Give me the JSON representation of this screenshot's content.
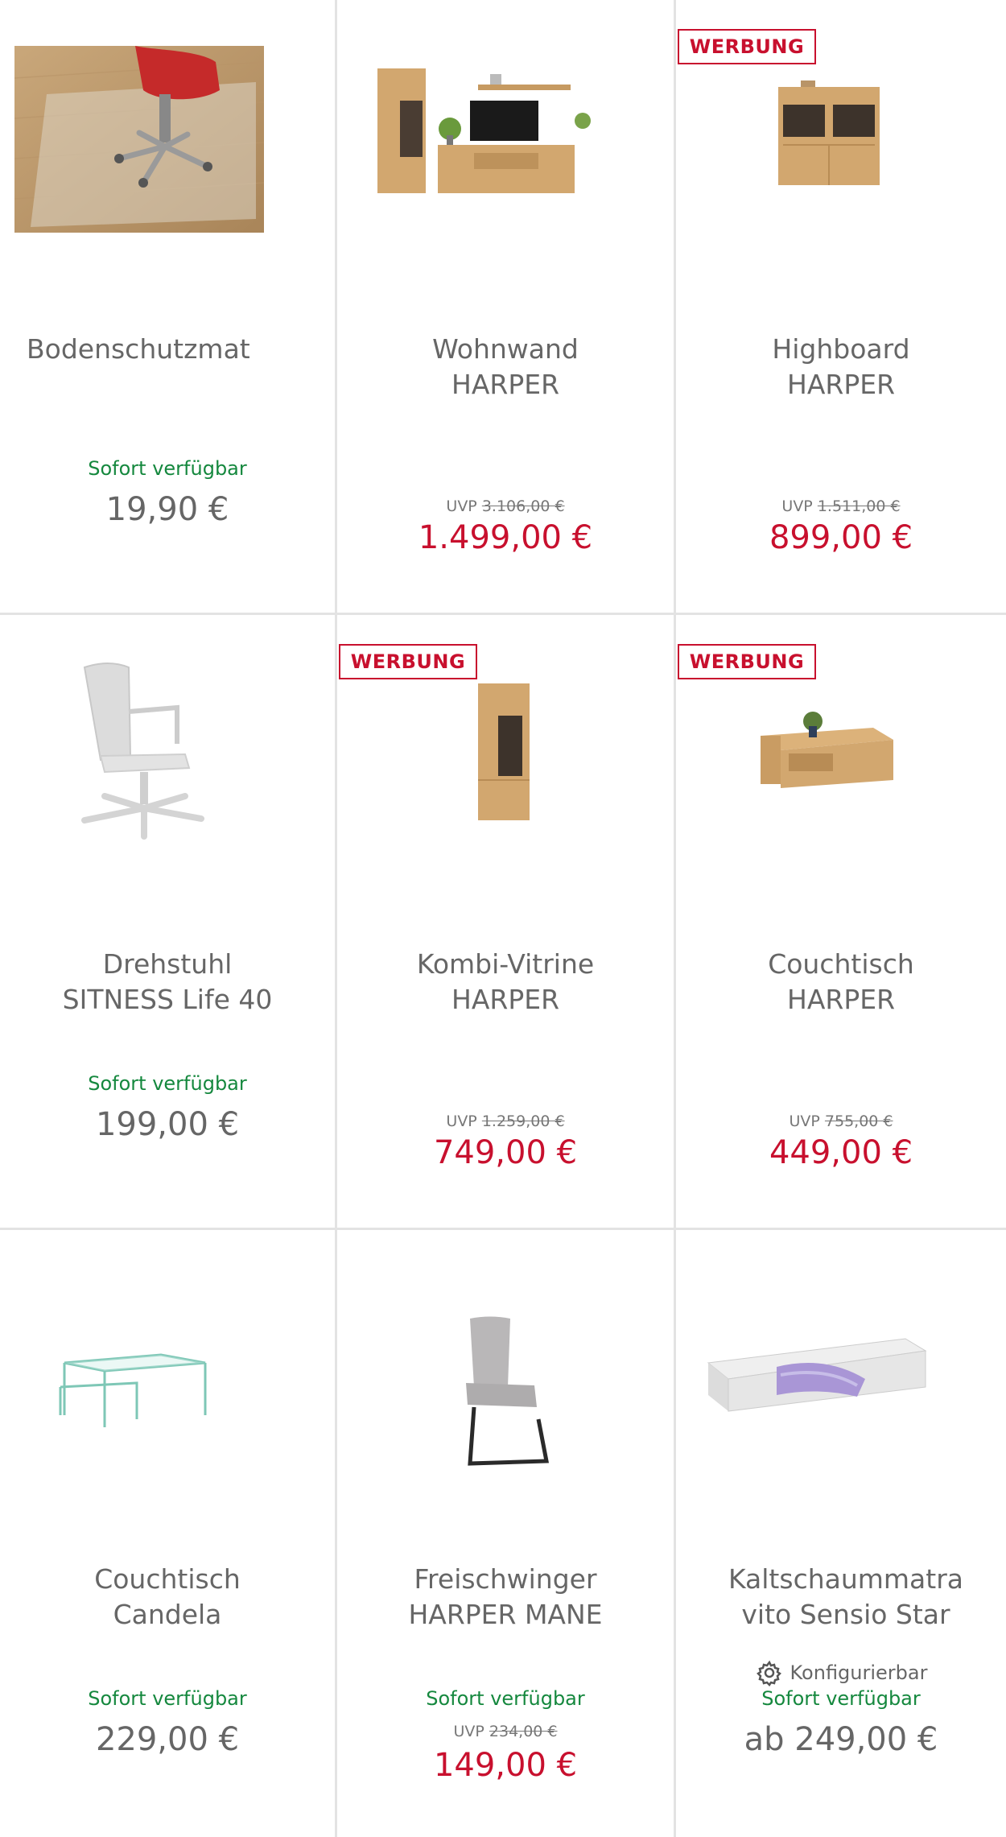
{
  "products": [
    {
      "badge": "",
      "title_line1": "Bodenschutzmat",
      "title_line2": "",
      "availability": "Sofort verfügbar",
      "uvp_label": "",
      "uvp_price": "",
      "price": "19,90 €",
      "image": "floor-mat-image"
    },
    {
      "badge": "",
      "title_line1": "Wohnwand",
      "title_line2": "HARPER",
      "availability": "",
      "uvp_label": "UVP",
      "uvp_price": "3.106,00 €",
      "price": "1.499,00 €",
      "image": "wall-unit-image"
    },
    {
      "badge": "WERBUNG",
      "title_line1": "Highboard",
      "title_line2": "HARPER",
      "availability": "",
      "uvp_label": "UVP",
      "uvp_price": "1.511,00 €",
      "price": "899,00 €",
      "image": "highboard-image"
    },
    {
      "badge": "",
      "title_line1": "Drehstuhl",
      "title_line2": "SITNESS Life 40",
      "availability": "Sofort verfügbar",
      "uvp_label": "",
      "uvp_price": "",
      "price": "199,00 €",
      "image": "office-chair-image"
    },
    {
      "badge": "WERBUNG",
      "title_line1": "Kombi-Vitrine",
      "title_line2": "HARPER",
      "availability": "",
      "uvp_label": "UVP",
      "uvp_price": "1.259,00 €",
      "price": "749,00 €",
      "image": "vitrine-image"
    },
    {
      "badge": "WERBUNG",
      "title_line1": "Couchtisch",
      "title_line2": "HARPER",
      "availability": "",
      "uvp_label": "UVP",
      "uvp_price": "755,00 €",
      "price": "449,00 €",
      "image": "coffee-table-wood-image"
    },
    {
      "badge": "",
      "title_line1": "Couchtisch",
      "title_line2": "Candela",
      "availability": "Sofort verfügbar",
      "uvp_label": "",
      "uvp_price": "",
      "price": "229,00 €",
      "image": "glass-table-image"
    },
    {
      "badge": "",
      "title_line1": "Freischwinger",
      "title_line2": "HARPER MANE",
      "availability": "Sofort verfügbar",
      "uvp_label": "UVP",
      "uvp_price": "234,00 €",
      "price": "149,00 €",
      "image": "cantilever-chair-image"
    },
    {
      "badge": "",
      "title_line1": "Kaltschaummatra",
      "title_line2": "vito Sensio Star",
      "configurable": "Konfigurierbar",
      "availability": "Sofort verfügbar",
      "uvp_label": "",
      "uvp_price": "",
      "price": "ab 249,00 €",
      "image": "mattress-image"
    }
  ],
  "colors": {
    "sale_red": "#c8102e",
    "available_green": "#15883e",
    "text_gray": "#666666",
    "divider": "#e3e3e3"
  }
}
